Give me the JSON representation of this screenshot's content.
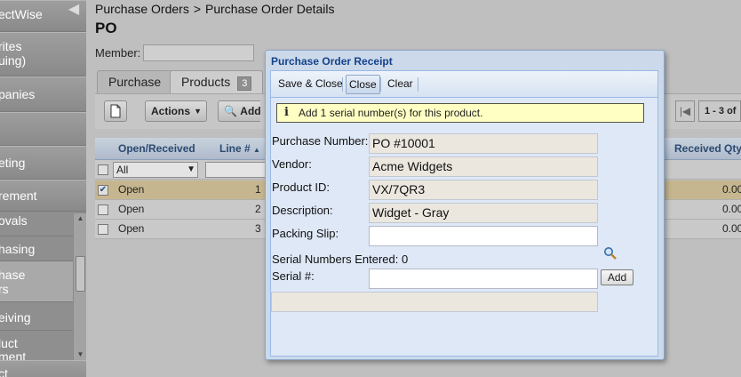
{
  "sidebar": {
    "items": [
      {
        "label": "ectWise"
      },
      {
        "label": "rites"
      },
      {
        "label": "uing)"
      },
      {
        "label": "panies"
      },
      {
        "label": "eting"
      },
      {
        "label": "rement"
      }
    ],
    "subitems": [
      {
        "label": "ovals"
      },
      {
        "label": "hasing"
      },
      {
        "label": "hase"
      },
      {
        "label": "rs"
      },
      {
        "label": "eiving"
      },
      {
        "label": "luct"
      },
      {
        "label": "ment"
      },
      {
        "label": "ct"
      }
    ],
    "collapse_glyph": "◀"
  },
  "breadcrumb": {
    "root": "Purchase Orders",
    "separator": ">",
    "current": "Purchase Order Details"
  },
  "page": {
    "title": "PO",
    "member_label": "Member:"
  },
  "tabs": [
    {
      "label": "Purchase"
    },
    {
      "label": "Products",
      "count": "3"
    }
  ],
  "toolbar": {
    "actions_label": "Actions",
    "add_label": "Add f",
    "pager_text": "1 - 3 of"
  },
  "grid": {
    "columns": [
      "Open/Received",
      "Line #",
      "Received Qty"
    ],
    "filter_value": "All",
    "rows": [
      {
        "status": "Open",
        "line": "1",
        "received_qty": "0.00",
        "checked": true
      },
      {
        "status": "Open",
        "line": "2",
        "received_qty": "0.00",
        "checked": false
      },
      {
        "status": "Open",
        "line": "3",
        "received_qty": "0.00",
        "checked": false
      }
    ]
  },
  "modal": {
    "title": "Purchase Order Receipt",
    "toolbar": {
      "save_close": "Save & Close",
      "close": "Close",
      "clear": "Clear"
    },
    "info": "Add 1 serial number(s) for this product.",
    "fields": {
      "purchase_number_label": "Purchase Number:",
      "purchase_number": "PO #10001",
      "vendor_label": "Vendor:",
      "vendor": "Acme Widgets",
      "product_id_label": "Product ID:",
      "product_id": "VX/7QR3",
      "description_label": "Description:",
      "description": "Widget - Gray",
      "packing_slip_label": "Packing Slip:",
      "packing_slip": "",
      "serial_entered_label": "Serial Numbers Entered: 0",
      "serial_label": "Serial #:",
      "serial_value": ""
    },
    "add_label": "Add"
  }
}
